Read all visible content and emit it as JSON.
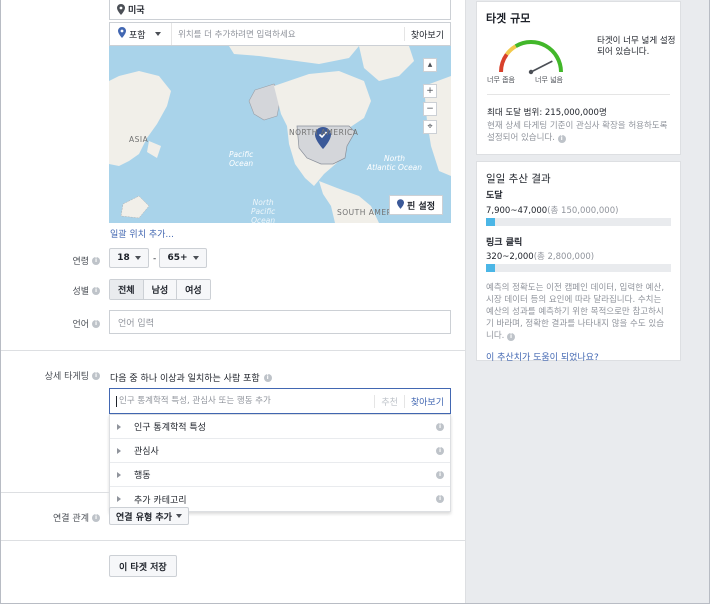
{
  "location": {
    "country": "미국",
    "mode": "포함",
    "placeholder": "위치를 더 추가하려면 입력하세요",
    "browse": "찾아보기",
    "pin_button": "핀 설정",
    "bulk_add": "일괄 위치 추가...",
    "map_labels": {
      "asia": "ASIA",
      "north_america": "NORTH AMERICA",
      "south_america": "SOUTH AMERICA",
      "pacific": "Pacific\nOcean",
      "north_pacific": "North\nPacific\nOcean",
      "atlantic": "North\nAtlantic Ocean"
    }
  },
  "age": {
    "label": "연령",
    "min": "18",
    "dash": "-",
    "max": "65+"
  },
  "gender": {
    "label": "성별",
    "options": [
      "전체",
      "남성",
      "여성"
    ],
    "selected": "전체"
  },
  "language": {
    "label": "언어",
    "placeholder": "언어 입력"
  },
  "detailed_targeting": {
    "label": "상세 타게팅",
    "description": "다음 중 하나 이상과 일치하는 사람 포함",
    "placeholder": "인구 통계학적 특성, 관심사 또는 행동 추가",
    "suggest": "추천",
    "browse": "찾아보기",
    "categories": [
      "인구 통계학적 특성",
      "관심사",
      "행동",
      "추가 카테고리"
    ]
  },
  "connections": {
    "label": "연결 관계",
    "dropdown": "연결 유형 추가"
  },
  "save_button": "이 타겟 저장",
  "audience_size": {
    "title": "타겟 규모",
    "status": "타겟이 너무 넓게 설정되어 있습니다.",
    "narrow_label": "너무 좁음",
    "broad_label": "너무 넓음",
    "reach": "최대 도달 범위: 215,000,000명",
    "reach_desc": "현재 상세 타게팅 기준이 관심사 확장을 허용하도록 설정되어 있습니다.",
    "gauge_level": 0.85
  },
  "daily_results": {
    "title": "일일 추산 결과",
    "reach_label": "도달",
    "reach_value": "7,900~47,000",
    "reach_of": "(총 150,000,000)",
    "reach_fraction": 0.05,
    "clicks_label": "링크 클릭",
    "clicks_value": "320~2,000",
    "clicks_of": "(총 2,800,000)",
    "clicks_fraction": 0.05,
    "note": "예측의 정확도는 이전 캠페인 데이터, 입력한 예산, 시장 데이터 등의 요인에 따라 달라집니다. 수치는 예산의 성과를 예측하기 위한 목적으로만 참고하시기 바라며, 정확한 결과를 나타내지 않을 수도 있습니다.",
    "helpful_link": "이 추산치가 도움이 되었나요?"
  },
  "colors": {
    "accent": "#4267b2",
    "bar_fill": "#4bb6e6",
    "gauge_red": "#d8402b",
    "gauge_yellow": "#f2c94c",
    "gauge_green": "#42b72a"
  }
}
